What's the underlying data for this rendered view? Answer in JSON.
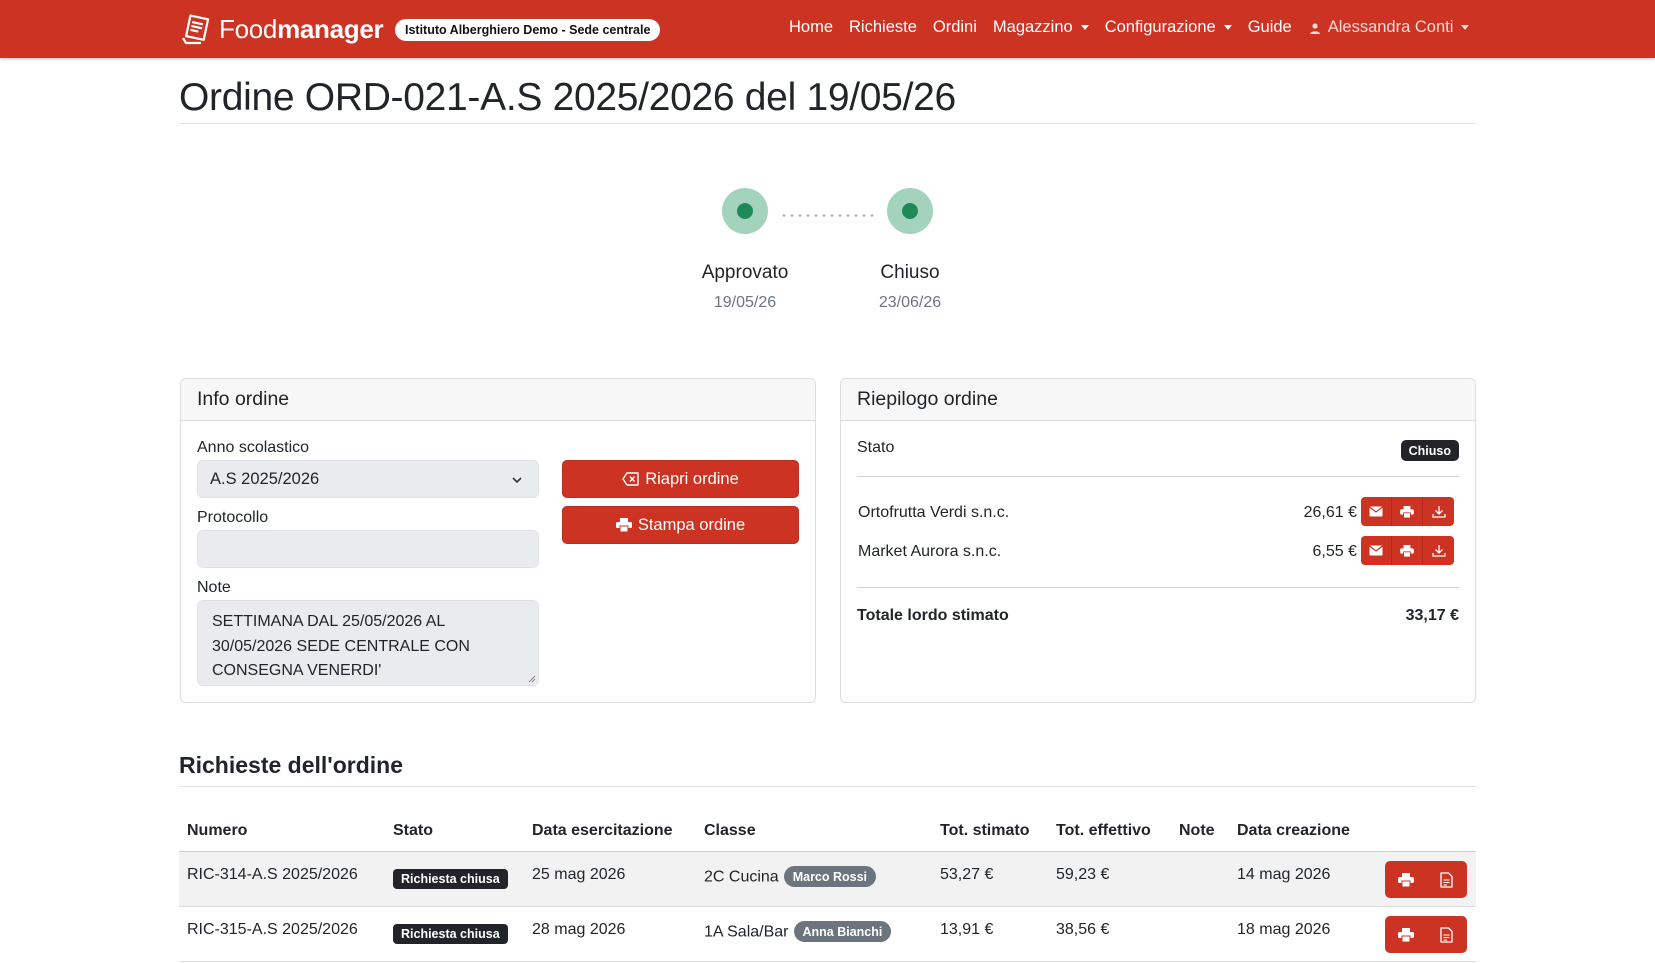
{
  "navbar": {
    "brand_light": "Food",
    "brand_bold": "manager",
    "school": "Istituto Alberghiero Demo - Sede centrale",
    "links": {
      "home": "Home",
      "richieste": "Richieste",
      "ordini": "Ordini",
      "magazzino": "Magazzino",
      "configurazione": "Configurazione",
      "guide": "Guide"
    },
    "user": "Alessandra Conti"
  },
  "page": {
    "title": "Ordine ORD-021-A.S 2025/2026 del 19/05/26"
  },
  "timeline": [
    {
      "label": "Approvato",
      "date": "19/05/26"
    },
    {
      "label": "Chiuso",
      "date": "23/06/26"
    }
  ],
  "info_card": {
    "header": "Info ordine",
    "anno_label": "Anno scolastico",
    "anno_value": "A.S 2025/2026",
    "protocollo_label": "Protocollo",
    "protocollo_value": "",
    "note_label": "Note",
    "note_value": "SETTIMANA DAL 25/05/2026 AL 30/05/2026 SEDE CENTRALE CON CONSEGNA VENERDI'",
    "reopen_label": "Riapri ordine",
    "print_label": "Stampa ordine"
  },
  "summary_card": {
    "header": "Riepilogo ordine",
    "stato_label": "Stato",
    "stato_value": "Chiuso",
    "suppliers": [
      {
        "name": "Ortofrutta Verdi s.n.c.",
        "amount": "26,61 €"
      },
      {
        "name": "Market Aurora s.n.c.",
        "amount": "6,55 €"
      }
    ],
    "total_label": "Totale lordo stimato",
    "total_value": "33,17 €"
  },
  "requests": {
    "title": "Richieste dell'ordine",
    "columns": [
      "Numero",
      "Stato",
      "Data esercitazione",
      "Classe",
      "Tot. stimato",
      "Tot. effettivo",
      "Note",
      "Data creazione"
    ],
    "rows": [
      {
        "numero": "RIC-314-A.S 2025/2026",
        "stato": "Richiesta chiusa",
        "data_esercitazione": "25 mag 2026",
        "classe": "2C Cucina",
        "docente": "Marco Rossi",
        "tot_stimato": "53,27 €",
        "tot_effettivo": "59,23 €",
        "note": "",
        "data_creazione": "14 mag 2026"
      },
      {
        "numero": "RIC-315-A.S 2025/2026",
        "stato": "Richiesta chiusa",
        "data_esercitazione": "28 mag 2026",
        "classe": "1A Sala/Bar",
        "docente": "Anna Bianchi",
        "tot_stimato": "13,91 €",
        "tot_effettivo": "38,56 €",
        "note": "",
        "data_creazione": "18 mag 2026"
      }
    ]
  },
  "colors": {
    "primary_red": "#cc3322",
    "success_green": "#1e8a57",
    "dark_badge": "#212529",
    "secondary_badge": "#6c757d"
  }
}
